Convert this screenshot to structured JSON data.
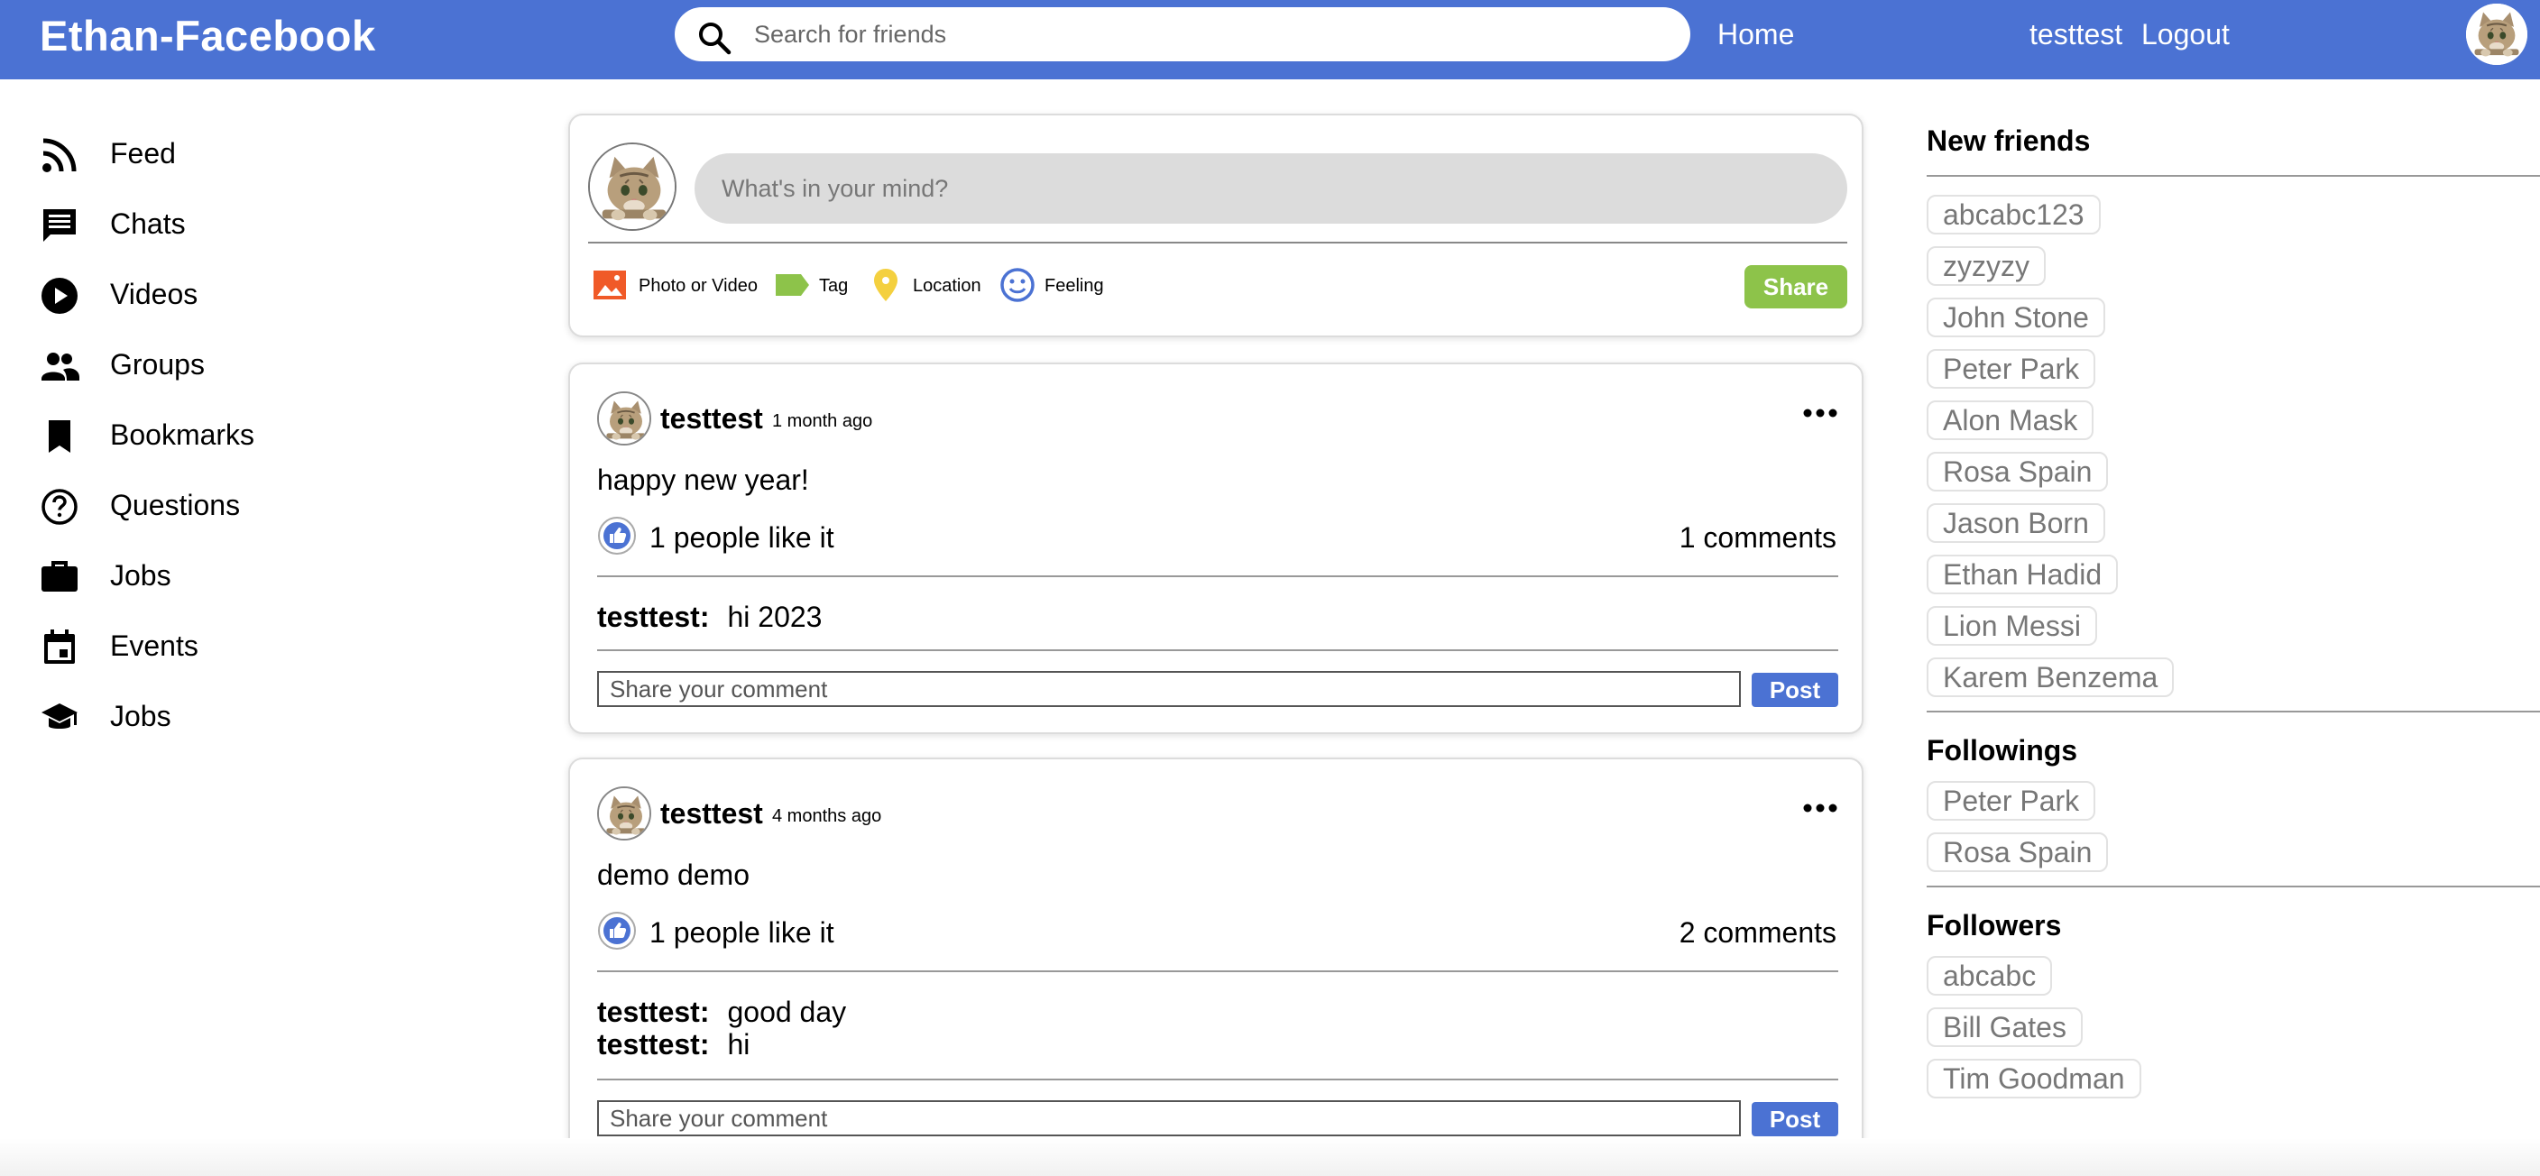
{
  "header": {
    "brand": "Ethan-Facebook",
    "search_placeholder": "Search for friends",
    "home": "Home",
    "username": "testtest",
    "logout": "Logout",
    "avatar_icon": "cat-avatar-icon",
    "color": "#4b72d3"
  },
  "sidebar": {
    "items": [
      {
        "label": "Feed",
        "icon": "rss-icon"
      },
      {
        "label": "Chats",
        "icon": "chat-icon"
      },
      {
        "label": "Videos",
        "icon": "play-circle-icon"
      },
      {
        "label": "Groups",
        "icon": "group-icon"
      },
      {
        "label": "Bookmarks",
        "icon": "bookmark-icon"
      },
      {
        "label": "Questions",
        "icon": "help-circle-icon"
      },
      {
        "label": "Jobs",
        "icon": "briefcase-icon"
      },
      {
        "label": "Events",
        "icon": "calendar-icon"
      },
      {
        "label": "Jobs",
        "icon": "graduation-cap-icon"
      }
    ]
  },
  "composer": {
    "placeholder": "What's in your mind?",
    "options": [
      {
        "label": "Photo or Video",
        "icon": "photo-icon",
        "color": "#f05a28"
      },
      {
        "label": "Tag",
        "icon": "tag-icon",
        "color": "#8dc34a"
      },
      {
        "label": "Location",
        "icon": "location-pin-icon",
        "color": "#f4d03f"
      },
      {
        "label": "Feeling",
        "icon": "smiley-icon",
        "color": "#4b72d3"
      }
    ],
    "share": "Share",
    "share_color": "#8dc34a"
  },
  "posts": [
    {
      "author": "testtest",
      "time": "1 month ago",
      "text": "happy new year!",
      "likes": "1 people like it",
      "comments_count": "1 comments",
      "comments": [
        {
          "author": "testtest:",
          "text": "hi 2023"
        }
      ],
      "comment_placeholder": "Share your comment",
      "post_button": "Post"
    },
    {
      "author": "testtest",
      "time": "4 months ago",
      "text": "demo demo",
      "likes": "1 people like it",
      "comments_count": "2 comments",
      "comments": [
        {
          "author": "testtest:",
          "text": "good day"
        },
        {
          "author": "testtest:",
          "text": "hi"
        }
      ],
      "comment_placeholder": "Share your comment",
      "post_button": "Post"
    }
  ],
  "right": {
    "new_friends_title": "New friends",
    "new_friends": [
      "abcabc123",
      "zyzyzy",
      "John Stone",
      "Peter Park",
      "Alon Mask",
      "Rosa Spain",
      "Jason Born",
      "Ethan Hadid",
      "Lion Messi",
      "Karem Benzema"
    ],
    "followings_title": "Followings",
    "followings": [
      "Peter Park",
      "Rosa Spain"
    ],
    "followers_title": "Followers",
    "followers": [
      "abcabc",
      "Bill Gates",
      "Tim Goodman"
    ]
  }
}
